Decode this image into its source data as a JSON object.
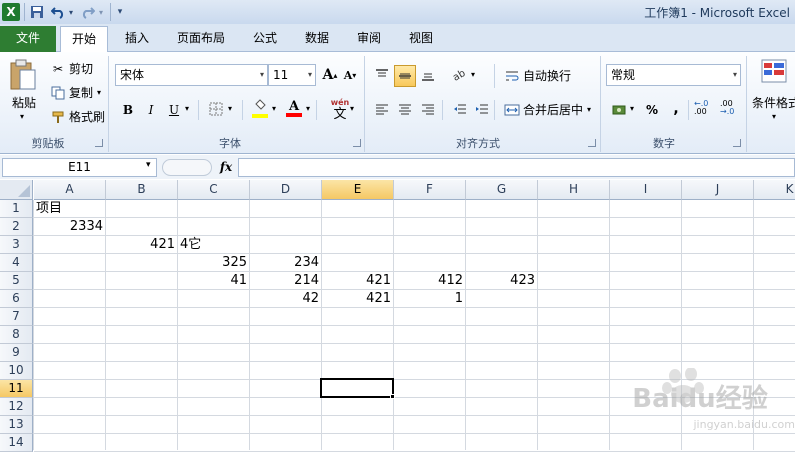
{
  "window": {
    "title": "工作簿1 - Microsoft Excel"
  },
  "quick_access": {
    "app_icon": "excel-icon",
    "save_icon": "save-icon",
    "undo_icon": "undo-icon",
    "redo_icon": "redo-icon",
    "customize_icon": "customize-icon"
  },
  "tabs": {
    "file": "文件",
    "home": "开始",
    "items": [
      "插入",
      "页面布局",
      "公式",
      "数据",
      "审阅",
      "视图"
    ]
  },
  "ribbon": {
    "clipboard": {
      "paste": "粘贴",
      "cut": "剪切",
      "copy": "复制",
      "format_painter": "格式刷",
      "group_label": "剪贴板"
    },
    "font": {
      "font_name": "宋体",
      "font_size": "11",
      "bold": "B",
      "italic": "I",
      "underline": "U",
      "grow": "A",
      "shrink": "A",
      "font_color_glyph": "A",
      "phonetic": "wén",
      "phonetic_sub": "文",
      "group_label": "字体",
      "fill_color": "#ffff00",
      "text_color": "#ff0000"
    },
    "alignment": {
      "wrap_text": "自动换行",
      "merge_center": "合并后居中",
      "group_label": "对齐方式"
    },
    "number": {
      "format": "常规",
      "percent": "%",
      "comma": ",",
      "inc_decimal": ".00",
      "dec_decimal": ".00",
      "group_label": "数字"
    },
    "styles": {
      "conditional": "条件格式"
    }
  },
  "formula_bar": {
    "name_box": "E11",
    "fx": "fx",
    "value": ""
  },
  "grid": {
    "columns": [
      "A",
      "B",
      "C",
      "D",
      "E",
      "F",
      "G",
      "H",
      "I",
      "J",
      "K"
    ],
    "rows": [
      "1",
      "2",
      "3",
      "4",
      "5",
      "6",
      "7",
      "8",
      "9",
      "10",
      "11",
      "12",
      "13",
      "14"
    ],
    "selected_col": "E",
    "selected_row": "11",
    "cells": {
      "A1": "项目",
      "A2": "2334",
      "B3": "421",
      "C3": "4它",
      "C4": "325",
      "D4": "234",
      "C5": "41",
      "D5": "214",
      "E5": "421",
      "F5": "412",
      "G5": "423",
      "D6": "42",
      "E6": "421",
      "F6": "1"
    }
  },
  "watermark": {
    "brand": "Baidu经验",
    "url": "jingyan.baidu.com"
  }
}
